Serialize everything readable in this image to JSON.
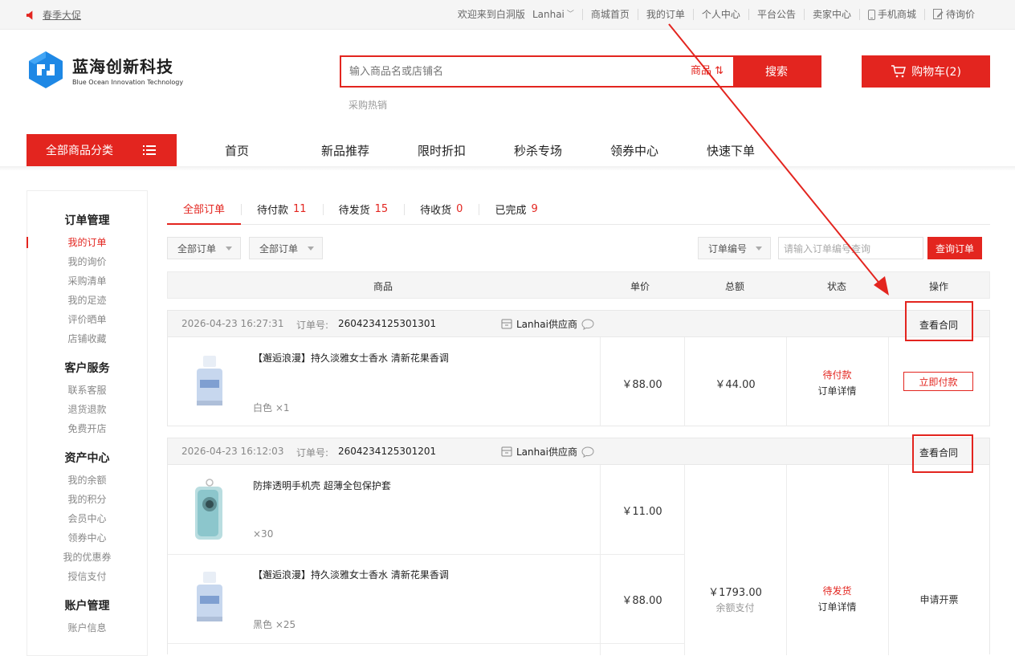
{
  "topbar": {
    "promo": "春季大促",
    "welcome": "欢迎来到白洞版",
    "user": "Lanhai",
    "links": [
      "商城首页",
      "我的订单",
      "个人中心",
      "平台公告",
      "卖家中心",
      "手机商城",
      "待询价"
    ]
  },
  "header": {
    "logo_cn": "蓝海创新科技",
    "logo_en": "Blue Ocean Innovation Technology",
    "search_placeholder": "输入商品名或店铺名",
    "search_scope": "商品 ⇅",
    "search_button": "搜索",
    "hot_label": "采购热销",
    "cart_label": "购物车(2)"
  },
  "nav": {
    "all_categories": "全部商品分类",
    "links": [
      "首页",
      "新品推荐",
      "限时折扣",
      "秒杀专场",
      "领券中心",
      "快速下单"
    ]
  },
  "sidebar": {
    "groups": [
      {
        "title": "订单管理",
        "items": [
          "我的订单",
          "我的询价",
          "采购清单",
          "我的足迹",
          "评价晒单",
          "店铺收藏"
        ]
      },
      {
        "title": "客户服务",
        "items": [
          "联系客服",
          "退货退款",
          "免费开店"
        ]
      },
      {
        "title": "资产中心",
        "items": [
          "我的余额",
          "我的积分",
          "会员中心",
          "领券中心",
          "我的优惠券",
          "授信支付"
        ]
      },
      {
        "title": "账户管理",
        "items": [
          "账户信息"
        ]
      }
    ]
  },
  "tabs": [
    {
      "label": "全部订单",
      "count": ""
    },
    {
      "label": "待付款",
      "count": "11"
    },
    {
      "label": "待发货",
      "count": "15"
    },
    {
      "label": "待收货",
      "count": "0"
    },
    {
      "label": "已完成",
      "count": "9"
    }
  ],
  "filters": {
    "select1": "全部订单",
    "select2": "全部订单",
    "field_select": "订单编号",
    "order_input_placeholder": "请输入订单编号查询",
    "query_button": "查询订单"
  },
  "table_headers": [
    "商品",
    "单价",
    "总额",
    "状态",
    "操作"
  ],
  "orders": [
    {
      "time": "2026-04-23 16:27:31",
      "no_label": "订单号:",
      "no": "2604234125301301",
      "shop": "Lanhai供应商",
      "contract": "查看合同",
      "items": [
        {
          "name": "【邂逅浪漫】持久淡雅女士香水 清新花果香调",
          "spec": "白色 ×1",
          "price": "￥88.00"
        }
      ],
      "total": "￥44.00",
      "status": "待付款",
      "detail": "订单详情",
      "action": "立即付款"
    },
    {
      "time": "2026-04-23 16:12:03",
      "no_label": "订单号:",
      "no": "2604234125301201",
      "shop": "Lanhai供应商",
      "contract": "查看合同",
      "items": [
        {
          "name": "防摔透明手机壳 超薄全包保护套",
          "spec": "×30",
          "price": "￥11.00"
        },
        {
          "name": "【邂逅浪漫】持久淡雅女士香水 清新花果香调",
          "spec": "黑色 ×25",
          "price": "￥88.00"
        }
      ],
      "total": "￥1793.00",
      "pay_method": "余额支付",
      "status": "待发货",
      "detail": "订单详情",
      "action": "申请开票"
    }
  ],
  "colors": {
    "brand_red": "#e3251f",
    "logo_blue": "#1e88e5"
  }
}
